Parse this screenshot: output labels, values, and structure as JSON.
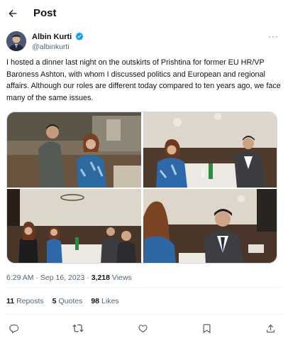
{
  "header": {
    "title": "Post",
    "back_icon": "arrow-left-icon"
  },
  "author": {
    "name": "Albin Kurti",
    "handle": "@albinkurti",
    "verified": true,
    "verified_color": "#1d9bf0"
  },
  "more_label": "···",
  "tweet": {
    "text": "I hosted a dinner last night on the outskirts of Prishtina for former EU HR/VP Baroness Ashton, with whom I discussed politics and European and regional affairs. Although our roles are different today compared to ten years ago, we face many of the same issues."
  },
  "media": {
    "count": 4
  },
  "meta": {
    "time": "6:29 AM",
    "separator": " · ",
    "date": "Sep 16, 2023",
    "separator2": " · ",
    "views_count": "3,218",
    "views_label": " Views"
  },
  "stats": {
    "reposts_count": "11",
    "reposts_label": "Reposts",
    "quotes_count": "5",
    "quotes_label": "Quotes",
    "likes_count": "98",
    "likes_label": "Likes"
  },
  "actions": [
    "reply-icon",
    "repost-icon",
    "like-icon",
    "bookmark-icon",
    "share-icon"
  ],
  "colors": {
    "text": "#0f1419",
    "secondary": "#536471",
    "accent": "#1d9bf0",
    "border": "#eff3f4"
  }
}
